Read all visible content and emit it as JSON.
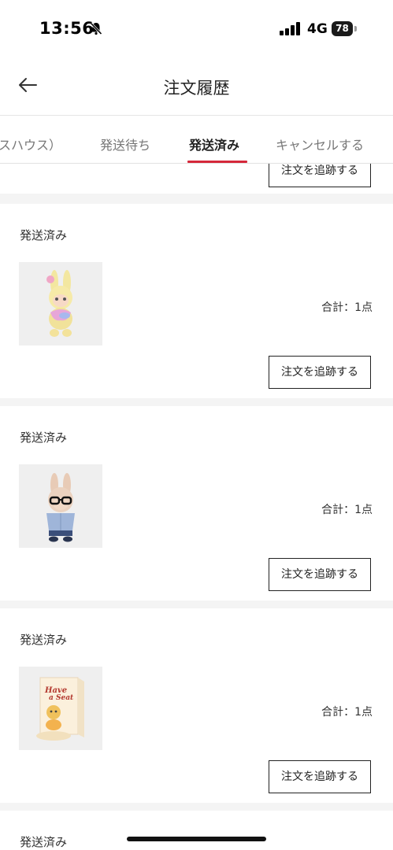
{
  "status_bar": {
    "time": "13:56",
    "network": "4G",
    "battery": "78"
  },
  "nav": {
    "title": "注文履歴"
  },
  "tabs": [
    {
      "label": "スハウス）"
    },
    {
      "label": "発送待ち"
    },
    {
      "label": "発送済み",
      "active": true
    },
    {
      "label": "キャンセルする"
    }
  ],
  "orders": [
    {
      "status": "",
      "total": "",
      "button": "注文を追跡する"
    },
    {
      "status": "発送済み",
      "total": "合計：1点",
      "button": "注文を追跡する",
      "product_icon": "yellow-bunny-figure-icon"
    },
    {
      "status": "発送済み",
      "total": "合計：1点",
      "button": "注文を追跡する",
      "product_icon": "glasses-bunny-figure-icon"
    },
    {
      "status": "発送済み",
      "total": "合計：1点",
      "button": "注文を追跡する",
      "product_icon": "blind-box-icon"
    },
    {
      "status": "発送済み"
    }
  ],
  "colors": {
    "accent": "#d5283a",
    "background": "#f4f4f4"
  }
}
